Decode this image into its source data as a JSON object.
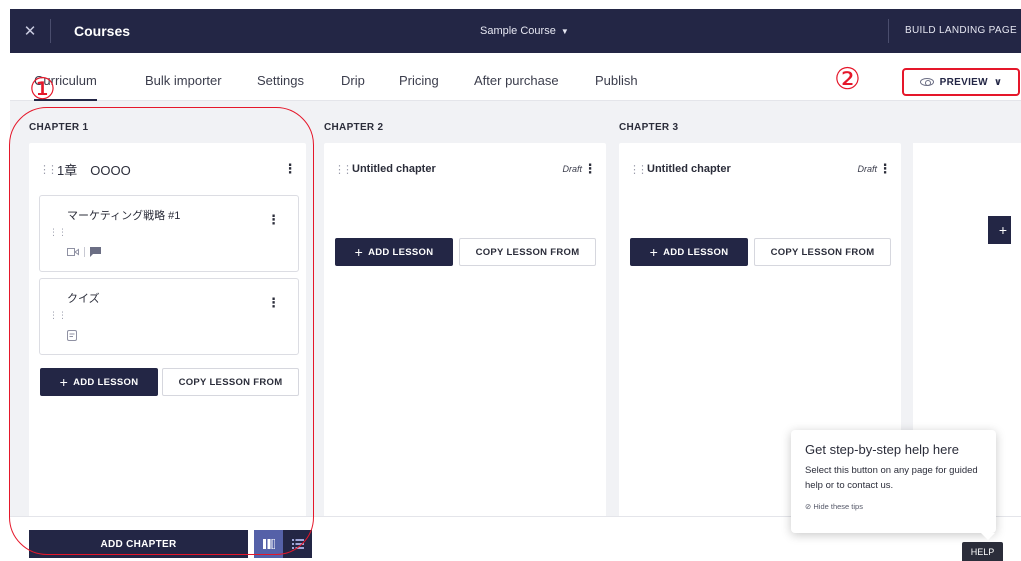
{
  "topbar": {
    "title": "Courses",
    "course_selector": "Sample Course",
    "build_landing": "BUILD LANDING PAGE  →"
  },
  "tabs": [
    {
      "label": "Curriculum",
      "active": true
    },
    {
      "label": "Bulk importer"
    },
    {
      "label": "Settings"
    },
    {
      "label": "Drip"
    },
    {
      "label": "Pricing"
    },
    {
      "label": "After purchase"
    },
    {
      "label": "Publish"
    }
  ],
  "preview_label": "PREVIEW",
  "chapters": [
    {
      "label": "CHAPTER 1",
      "name": "1章　OOOO",
      "lessons": [
        {
          "title": "マーケティング戦略 #1",
          "icons": [
            "video-icon",
            "comment-icon"
          ]
        },
        {
          "title": "クイズ",
          "icons": [
            "quiz-icon"
          ]
        }
      ]
    },
    {
      "label": "CHAPTER 2",
      "name": "Untitled chapter",
      "status": "Draft"
    },
    {
      "label": "CHAPTER 3",
      "name": "Untitled chapter",
      "status": "Draft"
    }
  ],
  "buttons": {
    "add_lesson": "ADD LESSON",
    "copy_lesson_from": "COPY LESSON FROM",
    "add_chapter": "ADD CHAPTER"
  },
  "help": {
    "title": "Get step-by-step help here",
    "body": "Select this button on any page for guided help or to contact us.",
    "hide_tips": "⊘ Hide these tips",
    "button": "HELP"
  },
  "annotations": {
    "marker_1": "①",
    "marker_2": "②",
    "color": "#e5172a"
  },
  "colors": {
    "navy": "#232645",
    "toggle_active": "#5561a8",
    "board_bg": "#f1f2f5"
  }
}
